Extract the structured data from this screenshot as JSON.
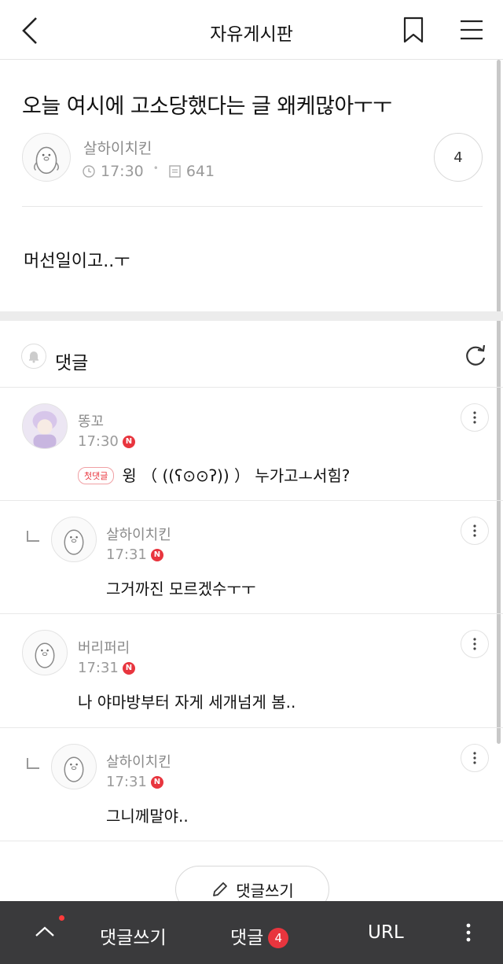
{
  "header": {
    "title": "자유게시판"
  },
  "post": {
    "title": "오늘 여시에 고소당했다는 글 왜케많아ㅜㅜ",
    "author": "살하이치킨",
    "time": "17:30",
    "views": "641",
    "comment_count": "4",
    "body": "머선일이고..ㅜ"
  },
  "comments_section": {
    "label": "댓글"
  },
  "comments": [
    {
      "name": "똥꼬",
      "time": "17:30",
      "badge": "N",
      "first_label": "첫댓글",
      "text": "윙 （ ((ʕ⊙⊙ʔ)) ） 누가고ㅗ서힘?"
    },
    {
      "name": "살하이치킨",
      "time": "17:31",
      "badge": "N",
      "text": "그거까진 모르겠수ㅜㅜ"
    },
    {
      "name": "버리퍼리",
      "time": "17:31",
      "badge": "N",
      "text": "나 야마방부터 자게 세개넘게 봄.."
    },
    {
      "name": "살하이치킨",
      "time": "17:31",
      "badge": "N",
      "text": "그니께말야.."
    }
  ],
  "write_button": {
    "label": "댓글쓰기"
  },
  "bottom_bar": {
    "write_label": "댓글쓰기",
    "comments_label": "댓글",
    "comments_count": "4",
    "url_label": "URL"
  },
  "colors": {
    "accent_red": "#e8353e",
    "bottom_bar_bg": "#3a3a3c"
  },
  "icons": [
    "back-icon",
    "bookmark-icon",
    "menu-icon",
    "clock-icon",
    "document-icon",
    "bell-icon",
    "refresh-icon",
    "more-icon",
    "pencil-icon",
    "chevron-up-icon"
  ]
}
